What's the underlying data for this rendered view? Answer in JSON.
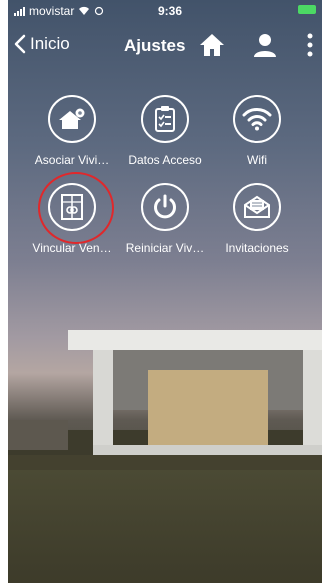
{
  "status_bar": {
    "carrier": "movistar",
    "time": "9:36"
  },
  "nav": {
    "back_label": "Inicio",
    "title": "Ajustes"
  },
  "tiles": [
    {
      "label": "Asociar Vivi…",
      "icon": "house-settings-icon"
    },
    {
      "label": "Datos Acceso",
      "icon": "clipboard-checklist-icon"
    },
    {
      "label": "Wifi",
      "icon": "wifi-icon"
    },
    {
      "label": "Vincular Ven…",
      "icon": "window-link-icon"
    },
    {
      "label": "Reiniciar Viv…",
      "icon": "power-icon"
    },
    {
      "label": "Invitaciones",
      "icon": "envelope-icon"
    }
  ],
  "colors": {
    "highlight": "#e0282b",
    "battery": "#4cd964"
  }
}
